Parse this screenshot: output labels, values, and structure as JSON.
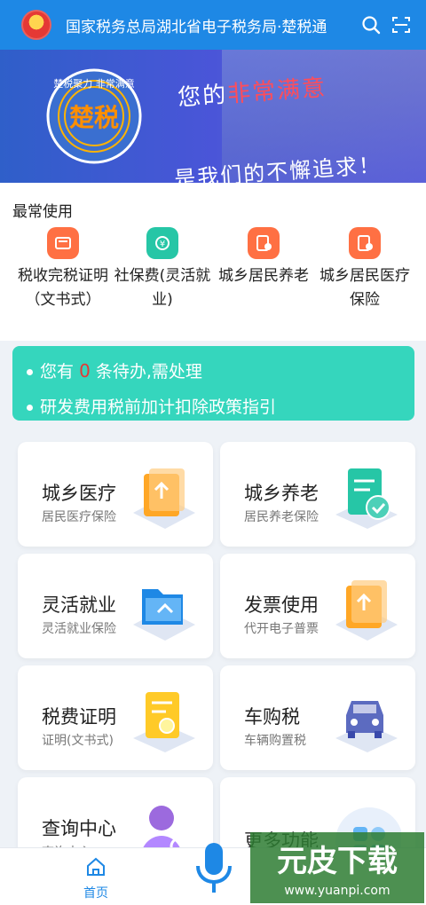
{
  "header": {
    "title": "国家税务总局湖北省电子税务局·楚税通",
    "icons": [
      "emblem-icon",
      "search-icon",
      "scan-icon"
    ],
    "color": "#1e88e5"
  },
  "banner": {
    "seal_text": "楚税聚力 非常满意",
    "seal_mark": "楚税",
    "slogan_line1_a": "您的",
    "slogan_line1_b": "非常满意",
    "slogan_line2": "是我们的不懈追求！"
  },
  "common": {
    "title": "最常使用",
    "items": [
      {
        "label": "税收完税证明（文书式）",
        "icon": "certificate-icon",
        "color": "#ff7043"
      },
      {
        "label": "社保费(灵活就业)",
        "icon": "social-insurance-icon",
        "color": "#26c6a6"
      },
      {
        "label": "城乡居民养老",
        "icon": "pension-icon",
        "color": "#ff7043"
      },
      {
        "label": "城乡居民医疗保险",
        "icon": "medical-icon",
        "color": "#ff7043"
      }
    ]
  },
  "notice": {
    "pending_prefix": "您有",
    "pending_count": "0",
    "pending_suffix": "条待办,需处理",
    "policy": "研发费用税前加计扣除政策指引",
    "color": "#35d6bd"
  },
  "cards": [
    {
      "title": "城乡医疗",
      "subtitle": "居民医疗保险",
      "icon": "upload-folder-icon"
    },
    {
      "title": "城乡养老",
      "subtitle": "居民养老保险",
      "icon": "document-check-icon"
    },
    {
      "title": "灵活就业",
      "subtitle": "灵活就业保险",
      "icon": "folder-icon"
    },
    {
      "title": "发票使用",
      "subtitle": "代开电子普票",
      "icon": "upload-folder-icon"
    },
    {
      "title": "税费证明",
      "subtitle": "证明(文书式)",
      "icon": "certificate-document-icon"
    },
    {
      "title": "车购税",
      "subtitle": "车辆购置税",
      "icon": "car-icon"
    },
    {
      "title": "查询中心",
      "subtitle": "查询中心",
      "icon": "user-search-icon"
    },
    {
      "title": "更多功能",
      "subtitle": "",
      "icon": "grid-icon"
    }
  ],
  "tabbar": {
    "home_label": "首页",
    "mic_icon": "microphone-icon"
  },
  "watermark": {
    "text": "元皮下载",
    "url": "www.yuanpi.com"
  }
}
